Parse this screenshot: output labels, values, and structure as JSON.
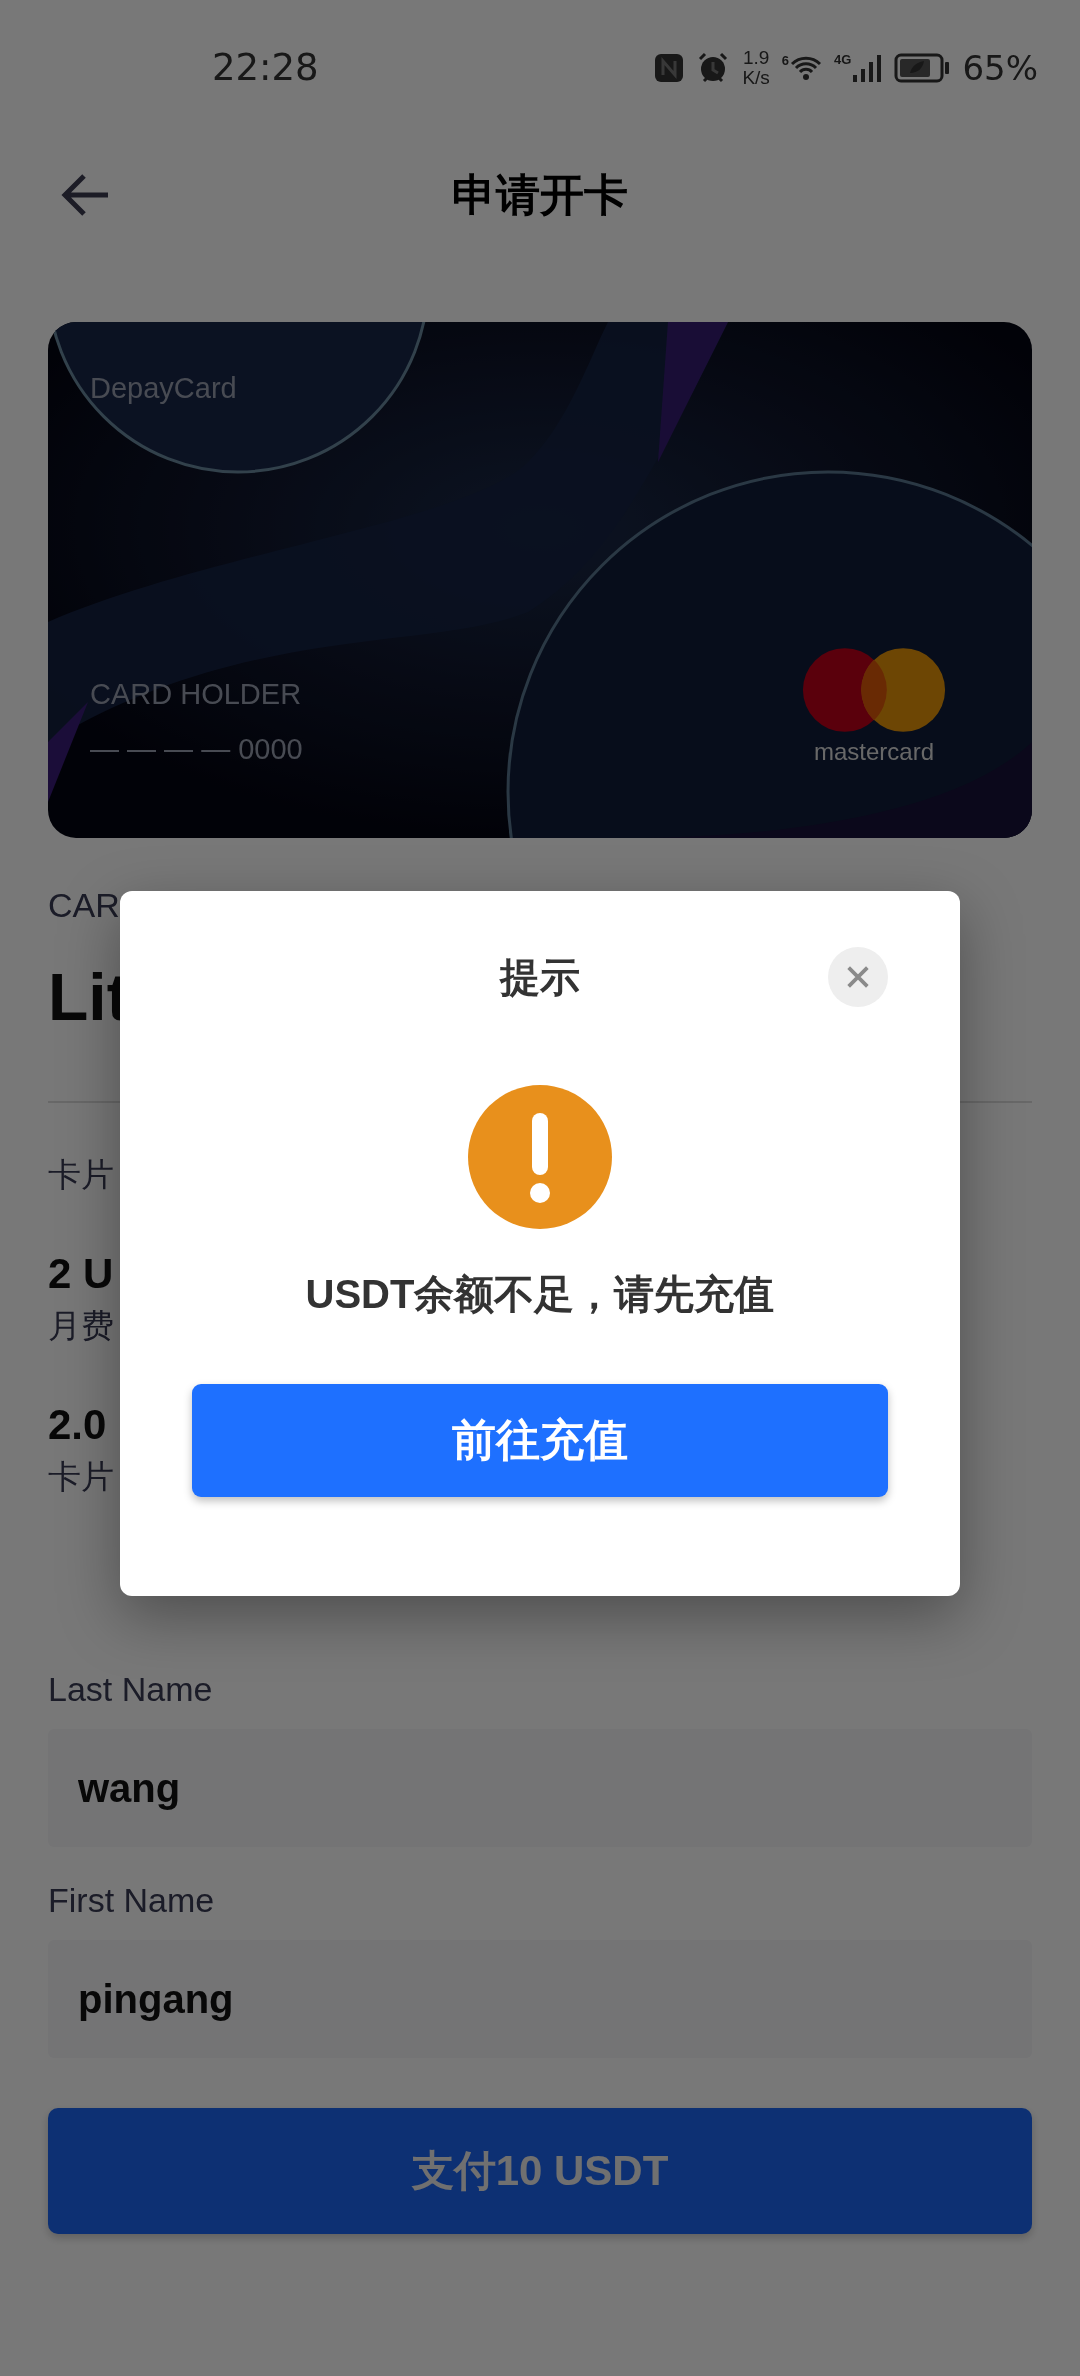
{
  "status_bar": {
    "time": "22:28",
    "net_speed": "1.9",
    "net_unit": "K/s",
    "wifi_badge": "6",
    "signal_badge": "4G",
    "battery": "65%"
  },
  "header": {
    "title": "申请开卡"
  },
  "card": {
    "brand": "DepayCard",
    "holder": "CARD HOLDER",
    "number": "— — — — 0000",
    "network": "mastercard"
  },
  "card_info": {
    "label": "CAR",
    "name": "Lit",
    "section_label": "卡片",
    "fees": [
      {
        "value": "2 U",
        "label": "月费"
      },
      {
        "value": "2.0",
        "label": "卡片"
      }
    ]
  },
  "form": {
    "fields": [
      {
        "label": "Last Name",
        "value": "wang"
      },
      {
        "label": "First Name",
        "value": "pingang"
      }
    ],
    "submit": "支付10 USDT"
  },
  "dialog": {
    "title": "提示",
    "message": "USDT余额不足，请先充值",
    "action": "前往充值"
  }
}
